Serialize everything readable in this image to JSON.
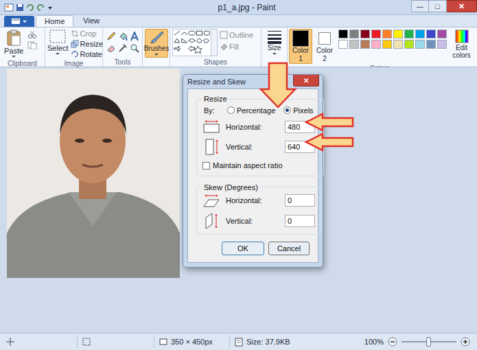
{
  "window": {
    "title": "p1_a.jpg - Paint",
    "controls": [
      "—",
      "□",
      "✕"
    ]
  },
  "tabs": [
    {
      "label": "Home",
      "selected": true
    },
    {
      "label": "View",
      "selected": false
    }
  ],
  "ribbon": {
    "clipboard": {
      "label": "Clipboard",
      "paste": "Paste"
    },
    "image": {
      "label": "Image",
      "select": "Select",
      "crop": "Crop",
      "resize": "Resize",
      "rotate": "Rotate"
    },
    "tools": {
      "label": "Tools"
    },
    "brushes": {
      "label": "Brushes",
      "selected": true
    },
    "shapes": {
      "label": "Shapes",
      "outline": "Outline",
      "fill": "Fill"
    },
    "size": "Size",
    "color1": {
      "label": "Color 1",
      "color": "#000000",
      "selected": true
    },
    "color2": {
      "label": "Color 2",
      "color": "#ffffff",
      "selected": false
    },
    "colors_label": "Colors",
    "edit_colors": "Edit colors",
    "palette": [
      {
        "color": "#000000"
      },
      {
        "color": "#7f7f7f"
      },
      {
        "color": "#880015"
      },
      {
        "color": "#ed1c24"
      },
      {
        "color": "#ff7f27"
      },
      {
        "color": "#fff200"
      },
      {
        "color": "#22b14c"
      },
      {
        "color": "#00a2e8"
      },
      {
        "color": "#3f48cc"
      },
      {
        "color": "#a349a4"
      },
      {
        "color": "#ffffff"
      },
      {
        "color": "#c3c3c3"
      },
      {
        "color": "#b97a57"
      },
      {
        "color": "#ffaec9"
      },
      {
        "color": "#ffc90e"
      },
      {
        "color": "#efe4b0"
      },
      {
        "color": "#b5e61d"
      },
      {
        "color": "#99d9ea"
      },
      {
        "color": "#7092be"
      },
      {
        "color": "#c8bfe7"
      }
    ]
  },
  "dialog": {
    "title": "Resize and Skew",
    "close": "✕",
    "resize_label": "Resize",
    "by": "By:",
    "units": [
      {
        "label": "Percentage",
        "selected": false
      },
      {
        "label": "Pixels",
        "selected": true
      }
    ],
    "resize_fields": [
      {
        "label": "Horizontal:",
        "value": "480"
      },
      {
        "label": "Vertical:",
        "value": "640"
      }
    ],
    "maintain": {
      "label": "Maintain aspect ratio",
      "checked": false
    },
    "skew_label": "Skew (Degrees)",
    "skew_fields": [
      {
        "label": "Horizontal:",
        "value": "0"
      },
      {
        "label": "Vertical:",
        "value": "0"
      }
    ],
    "buttons": [
      "OK",
      "Cancel"
    ]
  },
  "status_bar": {
    "dimensions": "350 × 450px",
    "size": "Size: 37.9KB",
    "zoom": "100%",
    "zoom_level": 0.5
  }
}
